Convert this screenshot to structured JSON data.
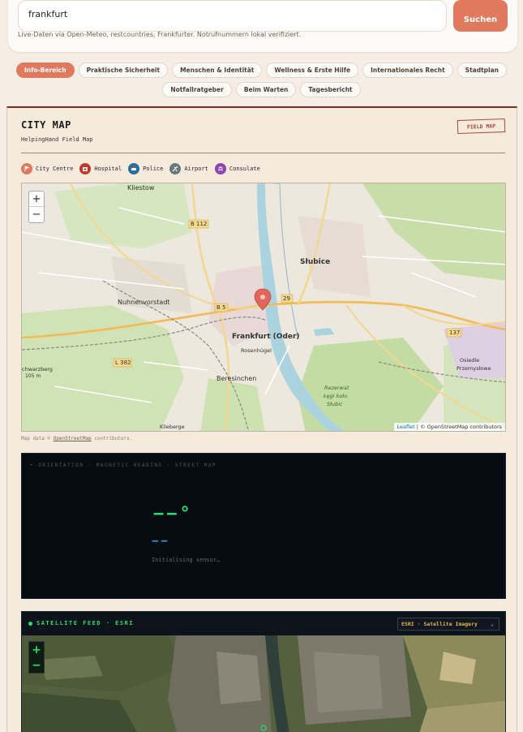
{
  "search": {
    "value": "frankfurt",
    "button_label": "Suchen",
    "source_note": "Live-Daten via Open-Meteo, restcountries, Frankfurter. Notrufnummern lokal verifiziert."
  },
  "tabs": [
    {
      "label": "Info-Bereich",
      "active": true
    },
    {
      "label": "Praktische Sicherheit",
      "active": false
    },
    {
      "label": "Menschen & Identität",
      "active": false
    },
    {
      "label": "Wellness & Erste Hilfe",
      "active": false
    },
    {
      "label": "Internationales Recht",
      "active": false
    },
    {
      "label": "Stadtplan",
      "active": false
    },
    {
      "label": "Notfallratgeber",
      "active": false
    },
    {
      "label": "Beim Warten",
      "active": false
    },
    {
      "label": "Tagesbericht",
      "active": false
    }
  ],
  "field_map": {
    "title": "CITY MAP",
    "subtitle": "HelpingHand Field Map",
    "stamp": "FIELD MAP",
    "legend": [
      {
        "label": "City Centre",
        "icon": "pin-icon",
        "color": "#e07a5f"
      },
      {
        "label": "Hospital",
        "icon": "hospital-icon",
        "color": "#c0392b"
      },
      {
        "label": "Police",
        "icon": "police-icon",
        "color": "#2c6e9b"
      },
      {
        "label": "Airport",
        "icon": "airplane-icon",
        "color": "#6b7780"
      },
      {
        "label": "Consulate",
        "icon": "building-icon",
        "color": "#8e44ad"
      }
    ],
    "map_labels": {
      "kliestow": "Kliestow",
      "b112": "B 112",
      "slubice": "Słubice",
      "nuhnenvorstadt": "Nuhnenvorstadt",
      "b5": "B 5",
      "r29": "29",
      "frankfurt": "Frankfurt (Oder)",
      "rosenhugel": "Rosenhügel",
      "r137": "137",
      "l382": "L 382",
      "beresinchen": "Beresinchen",
      "osiedle": "Osiedle",
      "przemyslowe": "Przemysłowe",
      "rezerwat1": "Rezerwat",
      "rezerwat2": "Łęgi koło",
      "rezerwat3": "Słubic",
      "schwarzberg": "chwarzberg",
      "height": "105 m",
      "klieberge": "Klieberge"
    },
    "zoom_in": "+",
    "zoom_out": "−",
    "attribution_leaflet": "Leaflet",
    "attribution_rest": " | © OpenStreetMap contributors",
    "credit_prefix": "Map data © ",
    "credit_link": "OpenStreetMap",
    "credit_suffix": " contributors."
  },
  "compass": {
    "header": "• ORIENTATION · MAGNETIC HEADING · STREET MAP",
    "heading_value": "−−°",
    "cardinal": "−−",
    "status": "Initialising sensor…"
  },
  "satellite": {
    "title": "SATELLITE FEED · ESRI",
    "source_select": "ESRI · Satellite Imagery",
    "zoom_in": "+",
    "zoom_out": "−"
  }
}
